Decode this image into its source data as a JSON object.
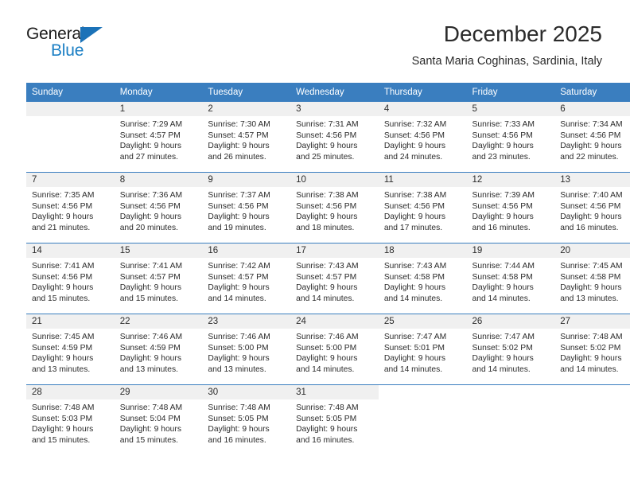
{
  "logo": {
    "word1": "General",
    "word2": "Blue",
    "triangle_color": "#1b72b8",
    "blue_color": "#1b7fc4"
  },
  "header": {
    "title": "December 2025",
    "subtitle": "Santa Maria Coghinas, Sardinia, Italy"
  },
  "theme": {
    "header_bg": "#3a7ebf",
    "daynum_bg": "#f0f0f0",
    "text": "#2b2b2b"
  },
  "calendar": {
    "weekday_headers": [
      "Sunday",
      "Monday",
      "Tuesday",
      "Wednesday",
      "Thursday",
      "Friday",
      "Saturday"
    ],
    "weeks": [
      [
        {
          "day": "",
          "sunrise": "",
          "sunset": "",
          "daylight1": "",
          "daylight2": "",
          "empty": true
        },
        {
          "day": "1",
          "sunrise": "Sunrise: 7:29 AM",
          "sunset": "Sunset: 4:57 PM",
          "daylight1": "Daylight: 9 hours",
          "daylight2": "and 27 minutes."
        },
        {
          "day": "2",
          "sunrise": "Sunrise: 7:30 AM",
          "sunset": "Sunset: 4:57 PM",
          "daylight1": "Daylight: 9 hours",
          "daylight2": "and 26 minutes."
        },
        {
          "day": "3",
          "sunrise": "Sunrise: 7:31 AM",
          "sunset": "Sunset: 4:56 PM",
          "daylight1": "Daylight: 9 hours",
          "daylight2": "and 25 minutes."
        },
        {
          "day": "4",
          "sunrise": "Sunrise: 7:32 AM",
          "sunset": "Sunset: 4:56 PM",
          "daylight1": "Daylight: 9 hours",
          "daylight2": "and 24 minutes."
        },
        {
          "day": "5",
          "sunrise": "Sunrise: 7:33 AM",
          "sunset": "Sunset: 4:56 PM",
          "daylight1": "Daylight: 9 hours",
          "daylight2": "and 23 minutes."
        },
        {
          "day": "6",
          "sunrise": "Sunrise: 7:34 AM",
          "sunset": "Sunset: 4:56 PM",
          "daylight1": "Daylight: 9 hours",
          "daylight2": "and 22 minutes."
        }
      ],
      [
        {
          "day": "7",
          "sunrise": "Sunrise: 7:35 AM",
          "sunset": "Sunset: 4:56 PM",
          "daylight1": "Daylight: 9 hours",
          "daylight2": "and 21 minutes."
        },
        {
          "day": "8",
          "sunrise": "Sunrise: 7:36 AM",
          "sunset": "Sunset: 4:56 PM",
          "daylight1": "Daylight: 9 hours",
          "daylight2": "and 20 minutes."
        },
        {
          "day": "9",
          "sunrise": "Sunrise: 7:37 AM",
          "sunset": "Sunset: 4:56 PM",
          "daylight1": "Daylight: 9 hours",
          "daylight2": "and 19 minutes."
        },
        {
          "day": "10",
          "sunrise": "Sunrise: 7:38 AM",
          "sunset": "Sunset: 4:56 PM",
          "daylight1": "Daylight: 9 hours",
          "daylight2": "and 18 minutes."
        },
        {
          "day": "11",
          "sunrise": "Sunrise: 7:38 AM",
          "sunset": "Sunset: 4:56 PM",
          "daylight1": "Daylight: 9 hours",
          "daylight2": "and 17 minutes."
        },
        {
          "day": "12",
          "sunrise": "Sunrise: 7:39 AM",
          "sunset": "Sunset: 4:56 PM",
          "daylight1": "Daylight: 9 hours",
          "daylight2": "and 16 minutes."
        },
        {
          "day": "13",
          "sunrise": "Sunrise: 7:40 AM",
          "sunset": "Sunset: 4:56 PM",
          "daylight1": "Daylight: 9 hours",
          "daylight2": "and 16 minutes."
        }
      ],
      [
        {
          "day": "14",
          "sunrise": "Sunrise: 7:41 AM",
          "sunset": "Sunset: 4:56 PM",
          "daylight1": "Daylight: 9 hours",
          "daylight2": "and 15 minutes."
        },
        {
          "day": "15",
          "sunrise": "Sunrise: 7:41 AM",
          "sunset": "Sunset: 4:57 PM",
          "daylight1": "Daylight: 9 hours",
          "daylight2": "and 15 minutes."
        },
        {
          "day": "16",
          "sunrise": "Sunrise: 7:42 AM",
          "sunset": "Sunset: 4:57 PM",
          "daylight1": "Daylight: 9 hours",
          "daylight2": "and 14 minutes."
        },
        {
          "day": "17",
          "sunrise": "Sunrise: 7:43 AM",
          "sunset": "Sunset: 4:57 PM",
          "daylight1": "Daylight: 9 hours",
          "daylight2": "and 14 minutes."
        },
        {
          "day": "18",
          "sunrise": "Sunrise: 7:43 AM",
          "sunset": "Sunset: 4:58 PM",
          "daylight1": "Daylight: 9 hours",
          "daylight2": "and 14 minutes."
        },
        {
          "day": "19",
          "sunrise": "Sunrise: 7:44 AM",
          "sunset": "Sunset: 4:58 PM",
          "daylight1": "Daylight: 9 hours",
          "daylight2": "and 14 minutes."
        },
        {
          "day": "20",
          "sunrise": "Sunrise: 7:45 AM",
          "sunset": "Sunset: 4:58 PM",
          "daylight1": "Daylight: 9 hours",
          "daylight2": "and 13 minutes."
        }
      ],
      [
        {
          "day": "21",
          "sunrise": "Sunrise: 7:45 AM",
          "sunset": "Sunset: 4:59 PM",
          "daylight1": "Daylight: 9 hours",
          "daylight2": "and 13 minutes."
        },
        {
          "day": "22",
          "sunrise": "Sunrise: 7:46 AM",
          "sunset": "Sunset: 4:59 PM",
          "daylight1": "Daylight: 9 hours",
          "daylight2": "and 13 minutes."
        },
        {
          "day": "23",
          "sunrise": "Sunrise: 7:46 AM",
          "sunset": "Sunset: 5:00 PM",
          "daylight1": "Daylight: 9 hours",
          "daylight2": "and 13 minutes."
        },
        {
          "day": "24",
          "sunrise": "Sunrise: 7:46 AM",
          "sunset": "Sunset: 5:00 PM",
          "daylight1": "Daylight: 9 hours",
          "daylight2": "and 14 minutes."
        },
        {
          "day": "25",
          "sunrise": "Sunrise: 7:47 AM",
          "sunset": "Sunset: 5:01 PM",
          "daylight1": "Daylight: 9 hours",
          "daylight2": "and 14 minutes."
        },
        {
          "day": "26",
          "sunrise": "Sunrise: 7:47 AM",
          "sunset": "Sunset: 5:02 PM",
          "daylight1": "Daylight: 9 hours",
          "daylight2": "and 14 minutes."
        },
        {
          "day": "27",
          "sunrise": "Sunrise: 7:48 AM",
          "sunset": "Sunset: 5:02 PM",
          "daylight1": "Daylight: 9 hours",
          "daylight2": "and 14 minutes."
        }
      ],
      [
        {
          "day": "28",
          "sunrise": "Sunrise: 7:48 AM",
          "sunset": "Sunset: 5:03 PM",
          "daylight1": "Daylight: 9 hours",
          "daylight2": "and 15 minutes."
        },
        {
          "day": "29",
          "sunrise": "Sunrise: 7:48 AM",
          "sunset": "Sunset: 5:04 PM",
          "daylight1": "Daylight: 9 hours",
          "daylight2": "and 15 minutes."
        },
        {
          "day": "30",
          "sunrise": "Sunrise: 7:48 AM",
          "sunset": "Sunset: 5:05 PM",
          "daylight1": "Daylight: 9 hours",
          "daylight2": "and 16 minutes."
        },
        {
          "day": "31",
          "sunrise": "Sunrise: 7:48 AM",
          "sunset": "Sunset: 5:05 PM",
          "daylight1": "Daylight: 9 hours",
          "daylight2": "and 16 minutes."
        },
        {
          "day": "",
          "sunrise": "",
          "sunset": "",
          "daylight1": "",
          "daylight2": "",
          "blank": true
        },
        {
          "day": "",
          "sunrise": "",
          "sunset": "",
          "daylight1": "",
          "daylight2": "",
          "blank": true
        },
        {
          "day": "",
          "sunrise": "",
          "sunset": "",
          "daylight1": "",
          "daylight2": "",
          "blank": true
        }
      ]
    ]
  }
}
